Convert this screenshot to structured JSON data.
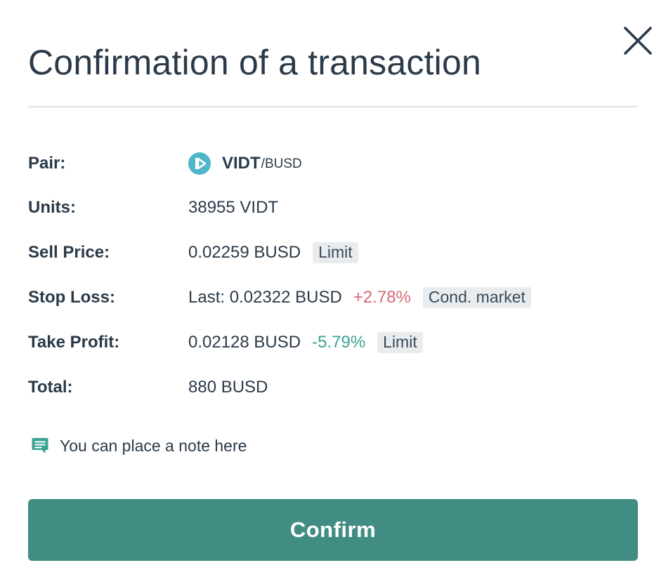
{
  "dialog": {
    "title": "Confirmation of a transaction",
    "close_icon": "close-icon"
  },
  "details": {
    "pair": {
      "label": "Pair:",
      "icon": "vidt-token-icon",
      "base": "VIDT",
      "quote": "/BUSD"
    },
    "units": {
      "label": "Units:",
      "value": "38955 VIDT"
    },
    "sell_price": {
      "label": "Sell Price:",
      "value": "0.02259 BUSD",
      "order_type": "Limit"
    },
    "stop_loss": {
      "label": "Stop Loss:",
      "value": "Last: 0.02322 BUSD",
      "change": "+2.78%",
      "order_type": "Cond. market"
    },
    "take_profit": {
      "label": "Take Profit:",
      "value": "0.02128 BUSD",
      "change": "-5.79%",
      "order_type": "Limit"
    },
    "total": {
      "label": "Total:",
      "value": "880 BUSD"
    }
  },
  "note": {
    "icon": "comment-icon",
    "text": "You can place a note here"
  },
  "actions": {
    "confirm_label": "Confirm"
  },
  "colors": {
    "primary": "#428d83",
    "positive_change": "#d66a73",
    "negative_change": "#3aa394",
    "tag_background": "#e8ecef",
    "pair_icon": "#4db6c8"
  }
}
